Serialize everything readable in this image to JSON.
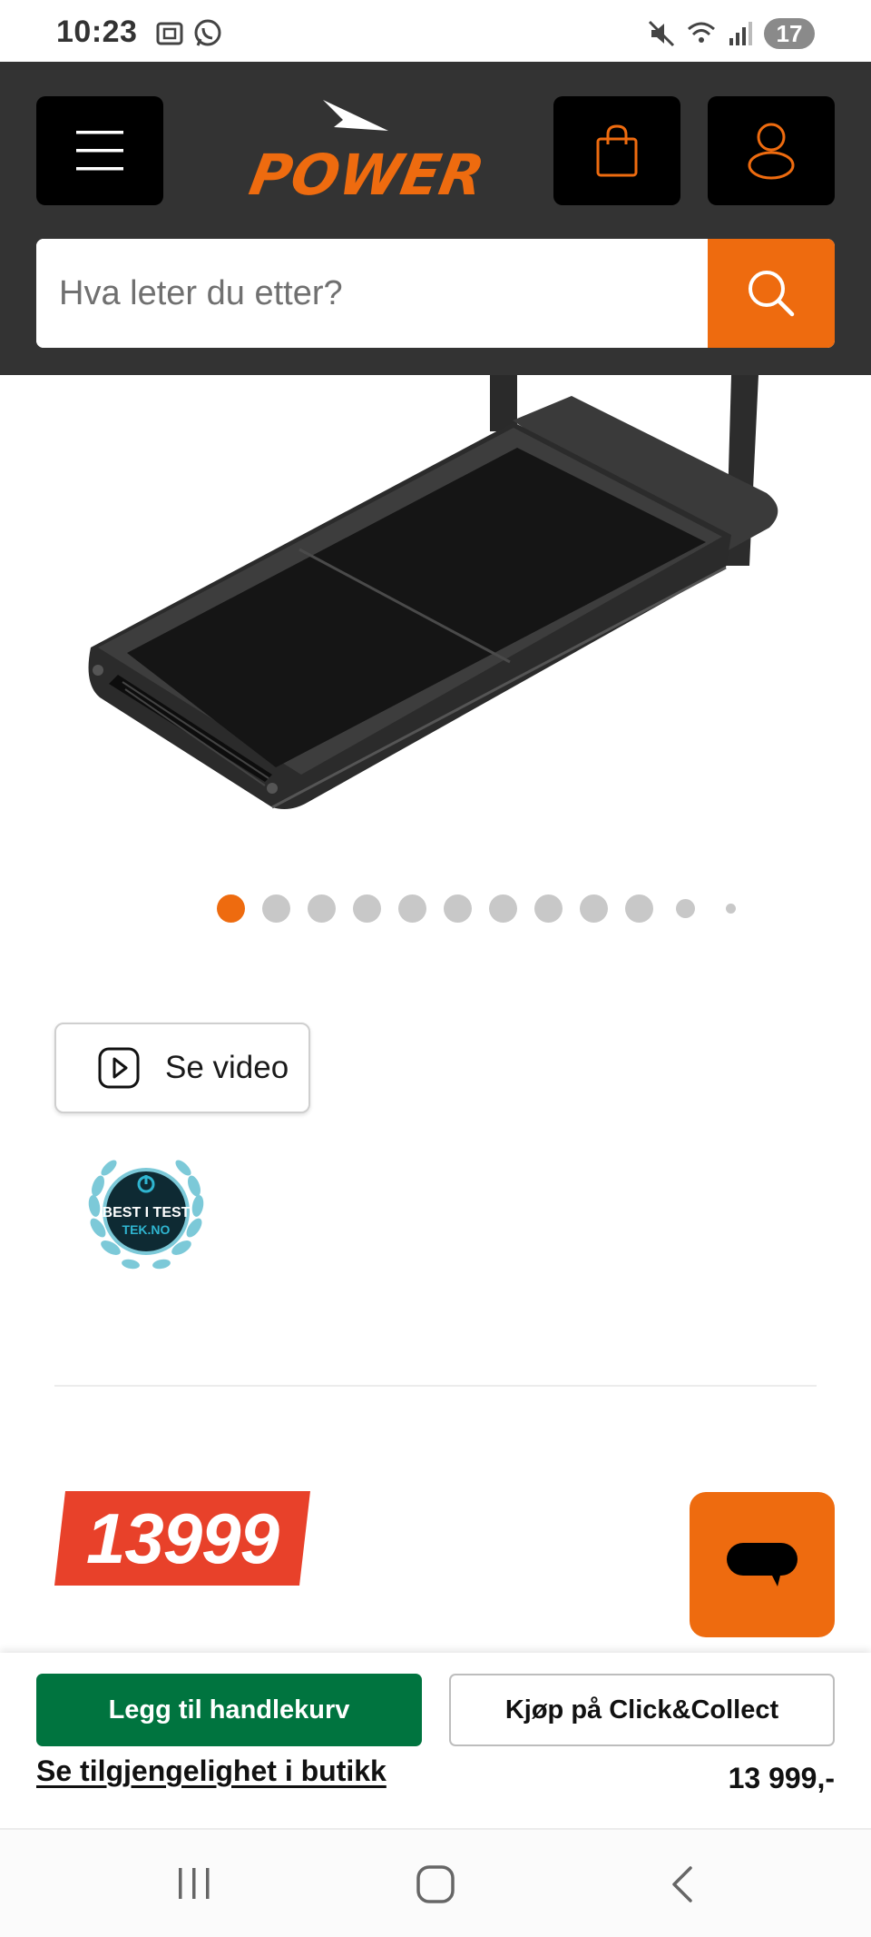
{
  "status_bar": {
    "time": "10:23",
    "battery": "17",
    "icons": [
      "screenshot-icon",
      "whatsapp-icon",
      "mute-icon",
      "wifi-icon",
      "signal-icon"
    ]
  },
  "header": {
    "logo_text": "POWER",
    "search": {
      "placeholder": "Hva leter du etter?"
    },
    "colors": {
      "background": "#333333",
      "accent": "#ee6b0f"
    }
  },
  "product": {
    "image_alt": "walking treadmill",
    "carousel": {
      "total_dots": 12,
      "active_index": 0
    },
    "video_label": "Se video",
    "badge": {
      "line1": "BEST I TEST",
      "line2": "TEK.NO"
    },
    "price_tag": "13999"
  },
  "bottom_bar": {
    "add_to_cart": "Legg til handlekurv",
    "click_collect": "Kjøp på Click&Collect",
    "availability_link": "Se tilgjengelighet i butikk",
    "price": "13 999,-",
    "colors": {
      "add_to_cart": "#00743f"
    }
  },
  "nav": {
    "icons": [
      "recent-apps-icon",
      "home-icon",
      "back-icon"
    ]
  }
}
